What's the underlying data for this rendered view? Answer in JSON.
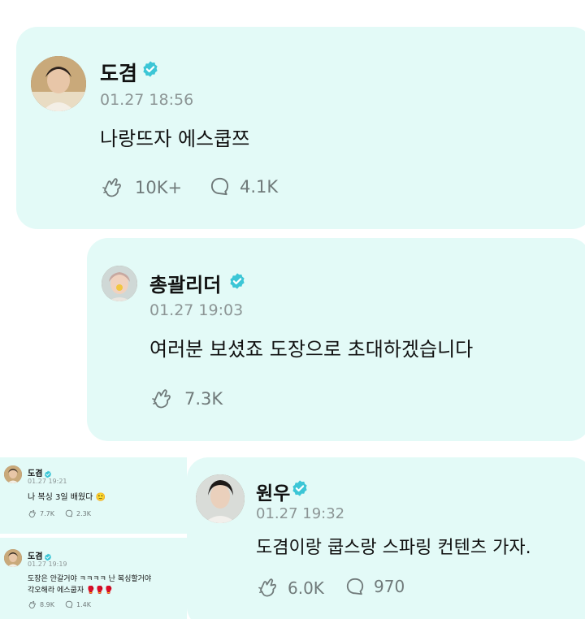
{
  "posts": [
    {
      "author": "도겸",
      "time": "01.27 18:56",
      "text": "나랑뜨자 에스쿱쯔",
      "reactions": "10K+",
      "comments": "4.1K"
    },
    {
      "author": "총괄리더",
      "time": "01.27 19:03",
      "text": "여러분 보셨죠 도장으로 초대하겠습니다",
      "reactions": "7.3K"
    },
    {
      "author": "원우",
      "time": "01.27 19:32",
      "text": "도겸이랑 쿱스랑 스파링 컨텐츠 가자.",
      "reactions": "6.0K",
      "comments": "970"
    }
  ],
  "mini_posts": [
    {
      "author": "도겸",
      "time": "01.27 19:21",
      "text": "나 복싱 3일 배웠다",
      "emoji": "🙂",
      "reactions": "7.7K",
      "comments": "2.3K"
    },
    {
      "author": "도겸",
      "time": "01.27 19:19",
      "text_line1": "도장은 안갈거야 ㅋㅋㅋㅋ 난 복싱할거야",
      "text_line2": "각오해라 에스쿱자",
      "emoji": "🥊🥊🥊",
      "reactions": "8.9K",
      "comments": "1.4K"
    }
  ],
  "icons": {
    "verified": "verified-badge-icon",
    "reaction": "cheer-reaction-icon",
    "comment": "comment-bubble-icon"
  },
  "colors": {
    "card_background": "#e3faf7",
    "verified": "#3cc6d6",
    "meta_text": "#8c9595"
  }
}
